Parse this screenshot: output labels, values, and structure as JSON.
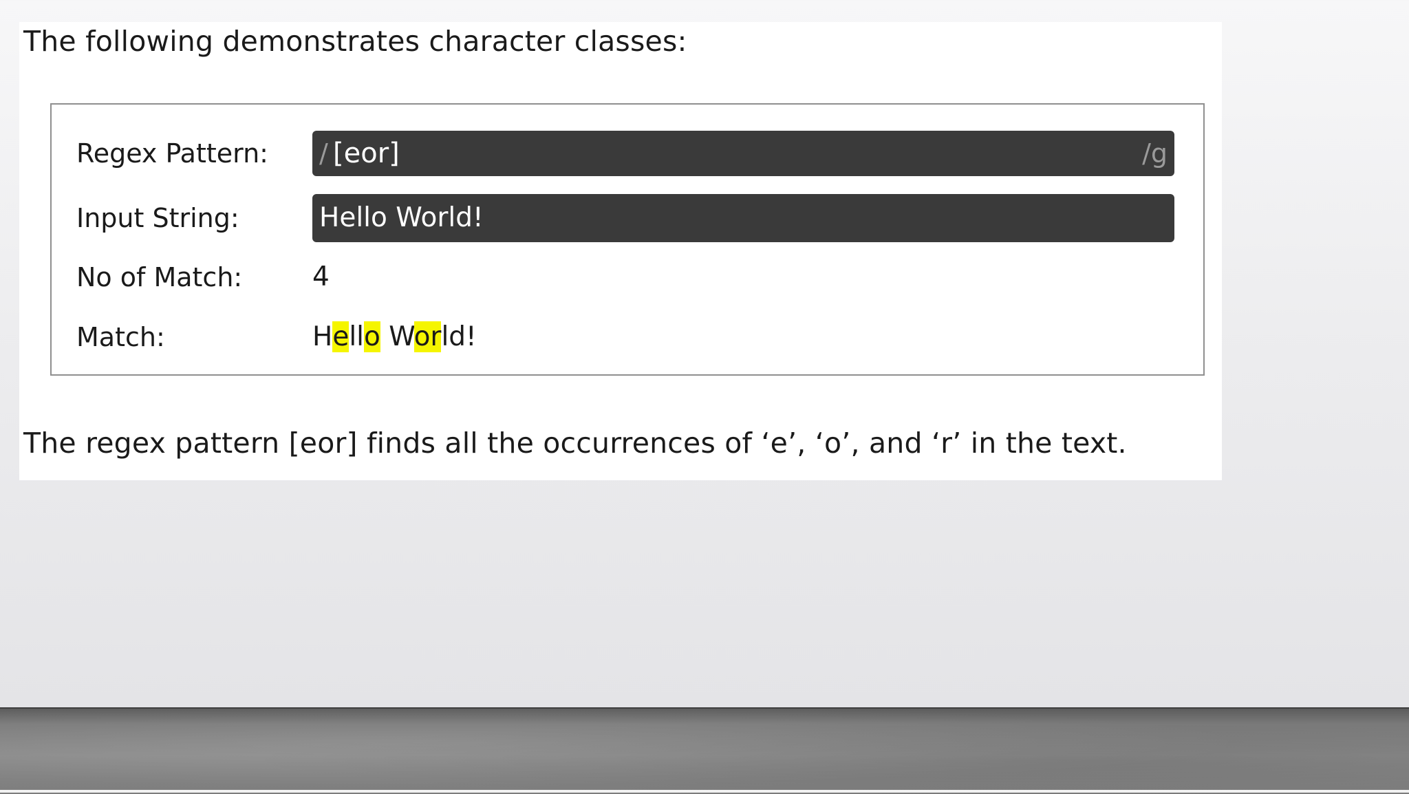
{
  "intro_text": "The following demonstrates character classes:",
  "regex_demo": {
    "pattern_label": "Regex Pattern:",
    "pattern_delimiter": "/",
    "pattern": "[eor]",
    "flags": "/g",
    "input_label": "Input String:",
    "input_value": "Hello World!",
    "match_count_label": "No of Match:",
    "match_count": "4",
    "match_label": "Match:",
    "match_segments": [
      {
        "text": "H",
        "highlighted": false
      },
      {
        "text": "e",
        "highlighted": true
      },
      {
        "text": "ll",
        "highlighted": false
      },
      {
        "text": "o",
        "highlighted": true
      },
      {
        "text": " W",
        "highlighted": false
      },
      {
        "text": "or",
        "highlighted": true
      },
      {
        "text": "ld!",
        "highlighted": false
      }
    ],
    "highlight_color": "#f5f500"
  },
  "outro_text": "The regex pattern [eor] finds all the occurrences of ‘e’, ‘o’, and ‘r’ in the text."
}
